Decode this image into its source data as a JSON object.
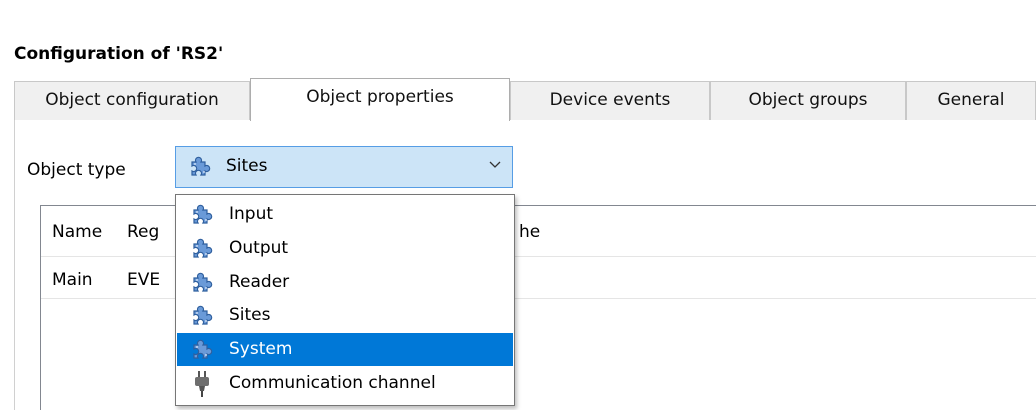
{
  "dialog": {
    "title": "Configuration of 'RS2'"
  },
  "tabs": [
    {
      "label": "Object configuration",
      "active": false
    },
    {
      "label": "Object properties",
      "active": true
    },
    {
      "label": "Device events",
      "active": false
    },
    {
      "label": "Object groups",
      "active": false
    },
    {
      "label": "General",
      "active": false
    }
  ],
  "object_type": {
    "label": "Object type",
    "selected_value": "Sites",
    "icon": "puzzle-piece-icon"
  },
  "properties_list": {
    "columns": [
      "Name",
      "Reg",
      "he"
    ],
    "rows": [
      {
        "name": "Main",
        "reg": "EVE"
      }
    ]
  },
  "dropdown": {
    "options": [
      {
        "label": "Input",
        "icon": "puzzle-piece-icon",
        "highlighted": false
      },
      {
        "label": "Output",
        "icon": "puzzle-piece-icon",
        "highlighted": false
      },
      {
        "label": "Reader",
        "icon": "puzzle-piece-icon",
        "highlighted": false
      },
      {
        "label": "Sites",
        "icon": "puzzle-piece-icon",
        "highlighted": false
      },
      {
        "label": "System",
        "icon": "puzzle-piece-icon",
        "highlighted": true
      },
      {
        "label": "Communication channel",
        "icon": "plug-icon",
        "highlighted": false
      }
    ]
  },
  "colors": {
    "selection_blue": "#0078d7",
    "combo_highlight": "#cce4f7",
    "puzzle_icon_blue": "#5b8fd0"
  }
}
